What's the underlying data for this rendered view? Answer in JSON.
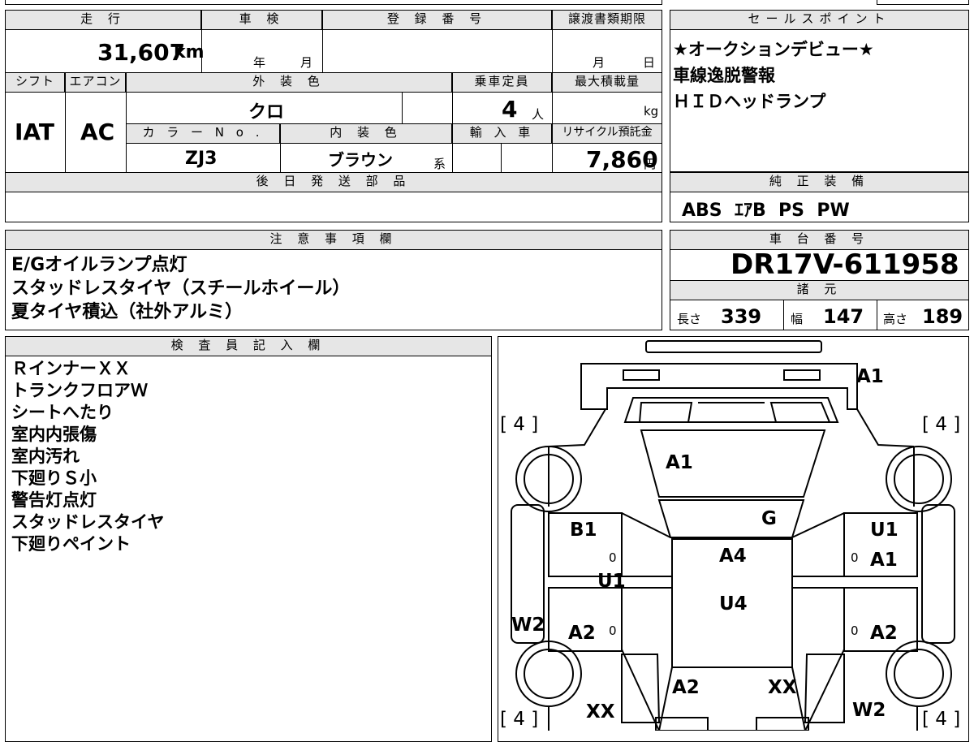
{
  "headers": {
    "mileage": "走 行",
    "inspection": "車 検",
    "registration": "登 録 番 号",
    "transfer_deadline": "譲渡書類期限",
    "sales_points": "セールスポイント",
    "shift": "シフト",
    "aircon": "エアコン",
    "exterior_color": "外 装 色",
    "capacity": "乗車定員",
    "max_load": "最大積載量",
    "color_no": "カ ラ ー N o .",
    "interior_color": "内 装 色",
    "import": "輸 入 車",
    "recycle_fee": "リサイクル預託金",
    "later_parts": "後 日 発 送 部 品",
    "standard_equipment": "純 正 装 備",
    "notes": "注 意 事 項 欄",
    "chassis_no": "車 台 番 号",
    "specs": "諸 元",
    "inspector": "検 査 員 記 入 欄"
  },
  "values": {
    "mileage": "31,607",
    "mileage_unit": "km",
    "year_label": "年",
    "month_label": "月",
    "transfer_month": "月",
    "transfer_day": "日",
    "shift": "IAT",
    "aircon": "AC",
    "exterior_color": "クロ",
    "capacity": "4",
    "capacity_unit": "人",
    "max_load_unit": "kg",
    "color_no": "ZJ3",
    "interior_color": "ブラウン",
    "interior_suffix": "系",
    "recycle_fee": "7,860",
    "recycle_unit": "円",
    "chassis_no": "DR17V-611958",
    "length_label": "長さ",
    "length": "339",
    "width_label": "幅",
    "width": "147",
    "height_label": "高さ",
    "height": "189"
  },
  "sales_points": [
    "★オークションデビュー★",
    "車線逸脱警報",
    "ＨＩＤヘッドランプ"
  ],
  "standard_equipment": "ABS  ｴｱB  PS  PW",
  "notes": [
    "E/Gオイルランプ点灯",
    "スタッドレスタイヤ（スチールホイール）",
    "夏タイヤ積込（社外アルミ）"
  ],
  "inspector_notes": [
    "ＲインナーＸＸ",
    "トランクフロアＷ",
    "シートへたり",
    "室内内張傷",
    "室内汚れ",
    "下廻りＳ小",
    "警告灯点灯",
    "スタッドレスタイヤ",
    "下廻りペイント"
  ],
  "diagram": {
    "tire_tl": "[ 4 ]",
    "tire_tr": "[ 4 ]",
    "tire_bl": "[ 4 ]",
    "tire_br": "[ 4 ]",
    "rear_bumper": "A1",
    "rear_glass": "A1",
    "left_rear_door": "B1",
    "roof_g": "G",
    "roof": "A4",
    "pillar_left": "U1",
    "right_rear_door_u": "U1",
    "right_rear_door_a": "A1",
    "roof_front": "U4",
    "left_sill": "W2",
    "left_front_door": "A2",
    "right_front_door": "A2",
    "hood": "A2",
    "front_right": "XX",
    "front_left_fender": "XX",
    "right_fender": "W2",
    "zero_marks": [
      "0",
      "0",
      "0",
      "0"
    ]
  }
}
